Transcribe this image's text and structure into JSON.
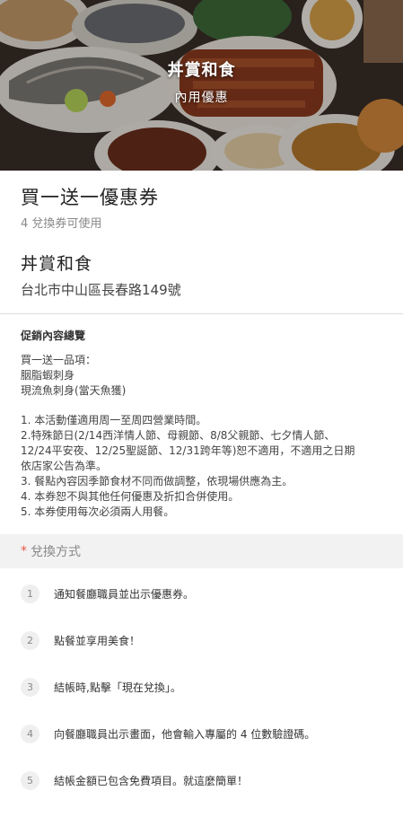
{
  "hero": {
    "title": "丼賞和食",
    "subtitle": "內用優惠"
  },
  "offer": {
    "title": "買一送一優惠券",
    "count_text": "4 兌換券可使用"
  },
  "merchant": {
    "name": "丼賞和食",
    "address": "台北市中山區長春路149號"
  },
  "promo": {
    "heading": "促銷內容總覽",
    "items_intro": "買一送一品項：",
    "items": [
      "胭脂蝦刺身",
      "現流魚刺身(當天魚獲)"
    ],
    "rules": [
      "1. 本活動僅適用周一至周四營業時間。",
      "2.特殊節日(2/14西洋情人節、母親節、8/8父親節、七夕情人節、",
      "12/24平安夜、12/25聖誕節、12/31跨年等)恕不適用，不適用之日期",
      "依店家公告為準。",
      "3. 餐點內容因季節食材不同而做調整，依現場供應為主。",
      "4. 本券恕不與其他任何優惠及折扣合併使用。",
      "5. 本券使用每次必須兩人用餐。"
    ]
  },
  "redeem": {
    "star": "*",
    "heading": "兌換方式",
    "steps": [
      {
        "num": "1",
        "text": "通知餐廳職員並出示優惠券。"
      },
      {
        "num": "2",
        "text": "點餐並享用美食！"
      },
      {
        "num": "3",
        "text": "結帳時,點擊「現在兌換」。"
      },
      {
        "num": "4",
        "text": "向餐廳職員出示畫面，他會輸入專屬的 4 位數驗證碼。"
      },
      {
        "num": "5",
        "text": "結帳金額已包含免費項目。就這麼簡單！"
      }
    ]
  }
}
